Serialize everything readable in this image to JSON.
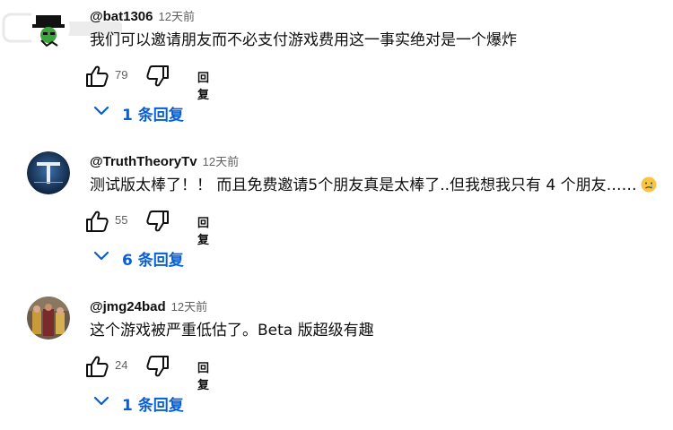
{
  "comments": [
    {
      "handle": "@bat1306",
      "time": "12天前",
      "text": "我们可以邀请朋友而不必支付游戏费用这一事实绝对是一个爆炸",
      "likes": "79",
      "reply_label": "回复",
      "replies_label": "1 条回复",
      "emoji": ""
    },
    {
      "handle": "@TruthTheoryTv",
      "time": "12天前",
      "text": "测试版太棒了！！ 而且免费邀请5个朋友真是太棒了..但我想我只有 4 个朋友……",
      "likes": "55",
      "reply_label": "回复",
      "replies_label": "6 条回复",
      "emoji": "😢"
    },
    {
      "handle": "@jmg24bad",
      "time": "12天前",
      "text": "这个游戏被严重低估了。Beta 版超级有趣",
      "likes": "24",
      "reply_label": "回复",
      "replies_label": "1 条回复",
      "emoji": ""
    }
  ],
  "colors": {
    "link": "#065fd4",
    "meta": "#606060",
    "text": "#0f0f0f"
  }
}
